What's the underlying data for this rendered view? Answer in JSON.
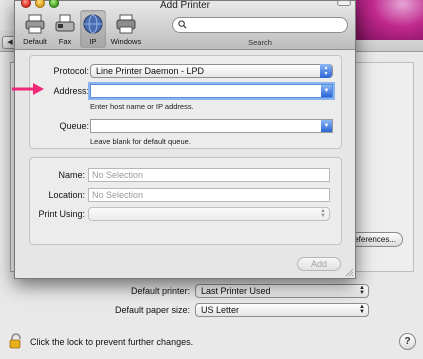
{
  "dialog": {
    "title": "Add Printer",
    "toolbar": [
      {
        "label": "Default",
        "icon": "printer-default-icon"
      },
      {
        "label": "Fax",
        "icon": "fax-icon"
      },
      {
        "label": "IP",
        "icon": "ip-globe-icon"
      },
      {
        "label": "Windows",
        "icon": "windows-printer-icon"
      }
    ],
    "search": {
      "placeholder": "",
      "caption": "Search"
    },
    "protocol": {
      "label": "Protocol:",
      "value": "Line Printer Daemon - LPD"
    },
    "address": {
      "label": "Address:",
      "value": "",
      "hint": "Enter host name or IP address."
    },
    "queue": {
      "label": "Queue:",
      "value": "",
      "hint": "Leave blank for default queue."
    },
    "name": {
      "label": "Name:",
      "placeholder": "No Selection"
    },
    "location": {
      "label": "Location:",
      "placeholder": "No Selection"
    },
    "print_using": {
      "label": "Print Using:",
      "value": ""
    },
    "add_button": "Add"
  },
  "background": {
    "preferences_button": "references...",
    "default_printer": {
      "label": "Default printer:",
      "value": "Last Printer Used"
    },
    "default_paper": {
      "label": "Default paper size:",
      "value": "US Letter"
    },
    "lock_text": "Click the lock to prevent further changes.",
    "help": "?"
  },
  "colors": {
    "focus": "#5a8ee0",
    "accent": "#2b64d6",
    "annotation_arrow": "#f0287a"
  }
}
